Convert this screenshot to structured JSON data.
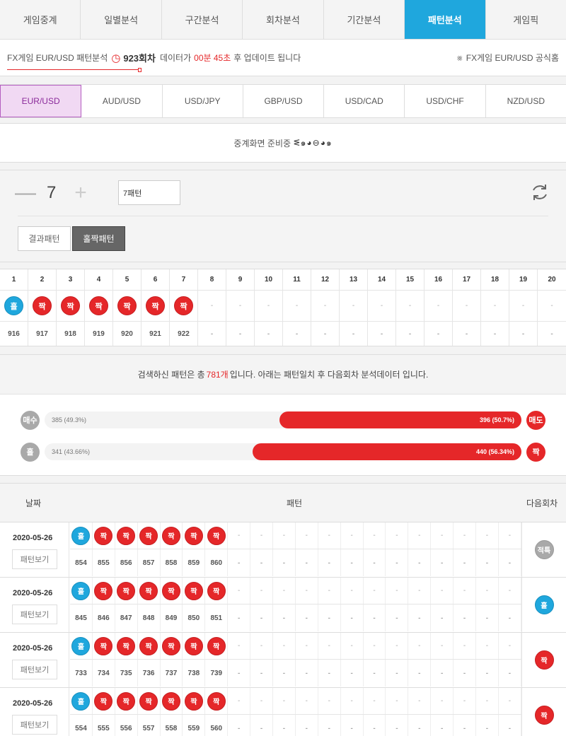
{
  "top_tabs": [
    {
      "label": "게임중계",
      "active": false
    },
    {
      "label": "일별분석",
      "active": false
    },
    {
      "label": "구간분석",
      "active": false
    },
    {
      "label": "회차분석",
      "active": false
    },
    {
      "label": "기간분석",
      "active": false
    },
    {
      "label": "패턴분석",
      "active": true
    },
    {
      "label": "게임픽",
      "active": false
    }
  ],
  "info": {
    "prefix": "FX게임 EUR/USD 패턴분석",
    "round": "923회차",
    "mid": "데이터가",
    "timer": "00분 45초",
    "suffix": "후 업데이트 됩니다",
    "official_link": "FX게임 EUR/USD 공식홈"
  },
  "currency_tabs": [
    {
      "label": "EUR/USD",
      "active": true
    },
    {
      "label": "AUD/USD",
      "active": false
    },
    {
      "label": "USD/JPY",
      "active": false
    },
    {
      "label": "GBP/USD",
      "active": false
    },
    {
      "label": "USD/CAD",
      "active": false
    },
    {
      "label": "USD/CHF",
      "active": false
    },
    {
      "label": "NZD/USD",
      "active": false
    }
  ],
  "relay": {
    "text": "중계화면 준비중",
    "dots": "ᓬ๑◕⊖◕๑"
  },
  "controls": {
    "count": "7",
    "pattern_value": "7패턴",
    "result_button": "결과패턴",
    "oddeven_button": "홀짝패턴"
  },
  "grid": {
    "headers": [
      "1",
      "2",
      "3",
      "4",
      "5",
      "6",
      "7",
      "8",
      "9",
      "10",
      "11",
      "12",
      "13",
      "14",
      "15",
      "16",
      "17",
      "18",
      "19",
      "20"
    ],
    "balls": [
      {
        "label": "홀",
        "color": "blue"
      },
      {
        "label": "짝",
        "color": "red"
      },
      {
        "label": "짝",
        "color": "red"
      },
      {
        "label": "짝",
        "color": "red"
      },
      {
        "label": "짝",
        "color": "red"
      },
      {
        "label": "짝",
        "color": "red"
      },
      {
        "label": "짝",
        "color": "red"
      },
      null,
      null,
      null,
      null,
      null,
      null,
      null,
      null,
      null,
      null,
      null,
      null,
      null
    ],
    "numbers": [
      "916",
      "917",
      "918",
      "919",
      "920",
      "921",
      "922",
      "",
      "",
      "",
      "",
      "",
      "",
      "",
      "",
      "",
      "",
      "",
      "",
      ""
    ],
    "dash": "-"
  },
  "summary": {
    "prefix": "검색하신 패턴은 총",
    "total": "781개",
    "suffix": "입니다. 아래는 패턴일치 후 다음회차 분석데이터 입니다.",
    "bars": [
      {
        "left_icon": "매수",
        "left_label": "385 (49.3%)",
        "right_label": "396 (50.7%)",
        "right_fraction": 0.507,
        "right_icon": "매도"
      },
      {
        "left_icon": "홀",
        "left_label": "341 (43.66%)",
        "right_label": "440 (56.34%)",
        "right_fraction": 0.5634,
        "right_icon": "짝"
      }
    ]
  },
  "history": {
    "header": {
      "date": "날짜",
      "pattern": "패턴",
      "next": "다음회차"
    },
    "view_label": "패턴보기",
    "rows": [
      {
        "date": "2020-05-26",
        "balls": [
          "홀",
          "짝",
          "짝",
          "짝",
          "짝",
          "짝",
          "짝"
        ],
        "colors": [
          "blue",
          "red",
          "red",
          "red",
          "red",
          "red",
          "red"
        ],
        "numbers": [
          "854",
          "855",
          "856",
          "857",
          "858",
          "859",
          "860"
        ],
        "next": {
          "label": "적특",
          "color": "gray"
        }
      },
      {
        "date": "2020-05-26",
        "balls": [
          "홀",
          "짝",
          "짝",
          "짝",
          "짝",
          "짝",
          "짝"
        ],
        "colors": [
          "blue",
          "red",
          "red",
          "red",
          "red",
          "red",
          "red"
        ],
        "numbers": [
          "845",
          "846",
          "847",
          "848",
          "849",
          "850",
          "851"
        ],
        "next": {
          "label": "홀",
          "color": "blue"
        }
      },
      {
        "date": "2020-05-26",
        "balls": [
          "홀",
          "짝",
          "짝",
          "짝",
          "짝",
          "짝",
          "짝"
        ],
        "colors": [
          "blue",
          "red",
          "red",
          "red",
          "red",
          "red",
          "red"
        ],
        "numbers": [
          "733",
          "734",
          "735",
          "736",
          "737",
          "738",
          "739"
        ],
        "next": {
          "label": "짝",
          "color": "red"
        }
      },
      {
        "date": "2020-05-26",
        "balls": [
          "홀",
          "짝",
          "짝",
          "짝",
          "짝",
          "짝",
          "짝"
        ],
        "colors": [
          "blue",
          "red",
          "red",
          "red",
          "red",
          "red",
          "red"
        ],
        "numbers": [
          "554",
          "555",
          "556",
          "557",
          "558",
          "559",
          "560"
        ],
        "next": {
          "label": "짝",
          "color": "red"
        }
      }
    ]
  },
  "colors": {
    "accent_blue": "#1fa7dd",
    "accent_red": "#e52729",
    "active_currency_bg": "#f1d9f3",
    "gray_ball": "#a9a9a9"
  }
}
